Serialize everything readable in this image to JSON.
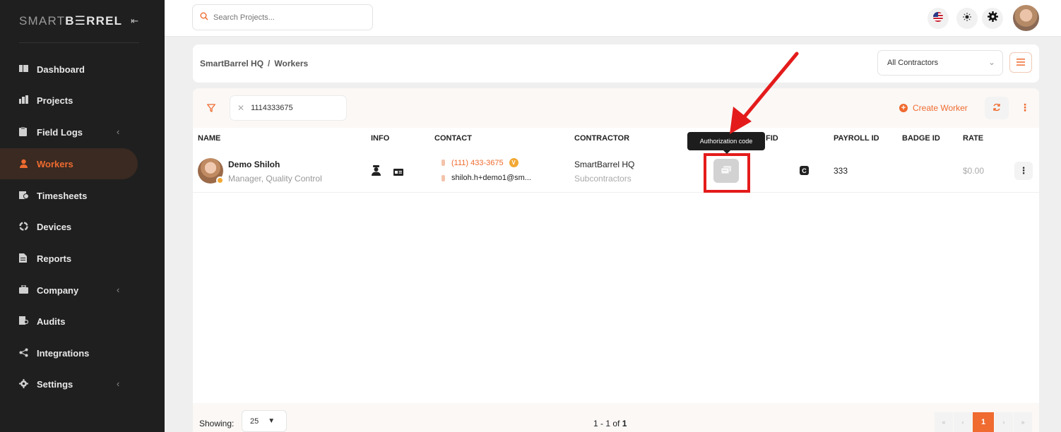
{
  "brand": {
    "part1": "SMART",
    "part2": "B☰RREL",
    "collapse_icon": "collapse-icon"
  },
  "sidebar": {
    "items": [
      {
        "label": "Dashboard",
        "icon": "dashboard-icon",
        "has_chevron": false,
        "active": false
      },
      {
        "label": "Projects",
        "icon": "projects-icon",
        "has_chevron": false,
        "active": false
      },
      {
        "label": "Field Logs",
        "icon": "field-logs-icon",
        "has_chevron": true,
        "active": false
      },
      {
        "label": "Workers",
        "icon": "workers-icon",
        "has_chevron": false,
        "active": true
      },
      {
        "label": "Timesheets",
        "icon": "timesheets-icon",
        "has_chevron": false,
        "active": false
      },
      {
        "label": "Devices",
        "icon": "devices-icon",
        "has_chevron": false,
        "active": false
      },
      {
        "label": "Reports",
        "icon": "reports-icon",
        "has_chevron": false,
        "active": false
      },
      {
        "label": "Company",
        "icon": "company-icon",
        "has_chevron": true,
        "active": false
      },
      {
        "label": "Audits",
        "icon": "audits-icon",
        "has_chevron": false,
        "active": false
      },
      {
        "label": "Integrations",
        "icon": "integrations-icon",
        "has_chevron": false,
        "active": false
      },
      {
        "label": "Settings",
        "icon": "settings-icon",
        "has_chevron": true,
        "active": false
      }
    ]
  },
  "topbar": {
    "search_placeholder": "Search Projects..."
  },
  "breadcrumb": {
    "root": "SmartBarrel HQ",
    "separator": "/",
    "current": "Workers"
  },
  "contractor_filter": {
    "selected": "All Contractors"
  },
  "filter": {
    "chip_value": "1114333675"
  },
  "toolbar": {
    "create_label": "Create Worker"
  },
  "table": {
    "columns": [
      "NAME",
      "INFO",
      "CONTACT",
      "CONTRACTOR",
      "FID",
      "PAYROLL ID",
      "BADGE ID",
      "RATE"
    ],
    "rows": [
      {
        "name": "Demo Shiloh",
        "role": "Manager, Quality Control",
        "phone": "(111) 433-3675",
        "phone_badge": "V",
        "email": "shiloh.h+demo1@sm...",
        "contractor": "SmartBarrel HQ",
        "contractor_type": "Subcontractors",
        "rfid_badge": "C",
        "payroll_id": "333",
        "badge_id": "",
        "rate": "$0.00"
      }
    ]
  },
  "tooltip": {
    "text": "Authorization code"
  },
  "footer": {
    "showing_label": "Showing:",
    "per_page": "25",
    "range_prefix": "1 - 1 of",
    "range_total": "1",
    "current_page": "1"
  },
  "colors": {
    "accent": "#ef6b2f",
    "sidebar_bg": "#1f1f1f",
    "annotation_red": "#e41b1b"
  }
}
